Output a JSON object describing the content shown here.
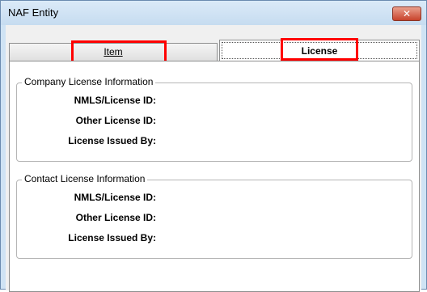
{
  "window": {
    "title": "NAF Entity",
    "close_symbol": "✕"
  },
  "tabs": [
    {
      "label": "Item",
      "selected": false,
      "highlighted": true
    },
    {
      "label": "License",
      "selected": true,
      "highlighted": true
    }
  ],
  "groups": [
    {
      "title": "Company License Information",
      "fields": [
        "NMLS/License ID:",
        "Other License ID:",
        "License Issued By:"
      ]
    },
    {
      "title": "Contact License Information",
      "fields": [
        "NMLS/License ID:",
        "Other License ID:",
        "License Issued By:"
      ]
    }
  ],
  "colors": {
    "highlight": "#ff0000",
    "titlebar": "#c6dcf0",
    "close_button": "#c8432c"
  }
}
